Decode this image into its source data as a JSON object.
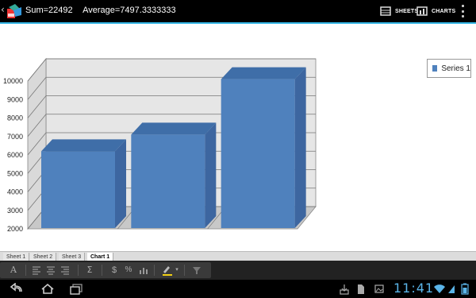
{
  "topbar": {
    "sum_text": "Sum=22492",
    "average_text": "Average=7497.3333333",
    "sheets_label": "SHEETS",
    "charts_label": "CHARTS"
  },
  "chart_data": {
    "type": "bar",
    "categories": [
      "",
      "",
      ""
    ],
    "series": [
      {
        "name": "Series 1",
        "values": [
          6200,
          7100,
          10100
        ]
      }
    ],
    "title": "",
    "xlabel": "",
    "ylabel": "",
    "ylim": [
      2000,
      10000
    ],
    "yticks": [
      2000,
      3000,
      4000,
      5000,
      6000,
      7000,
      8000,
      9000,
      10000
    ],
    "grid": true,
    "legend": "top-right",
    "style": "3d",
    "color": "#4f81bd"
  },
  "sheets": {
    "tabs": [
      "Sheet 1",
      "Sheet 2",
      "Sheet 3",
      "Chart 1"
    ],
    "active": "Chart 1"
  },
  "status": {
    "clock": "11:41"
  }
}
